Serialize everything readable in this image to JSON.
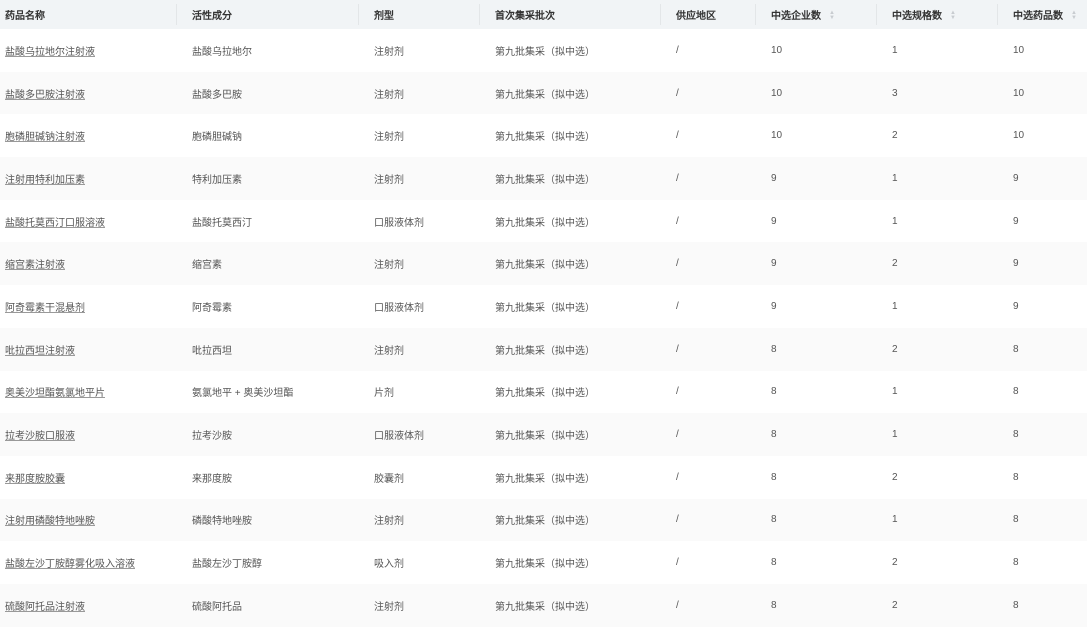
{
  "columns": [
    "药品名称",
    "活性成分",
    "剂型",
    "首次集采批次",
    "供应地区",
    "中选企业数",
    "中选规格数",
    "中选药品数"
  ],
  "rows": [
    [
      "盐酸乌拉地尔注射液",
      "盐酸乌拉地尔",
      "注射剂",
      "第九批集采（拟中选）",
      "/",
      "10",
      "1",
      "10"
    ],
    [
      "盐酸多巴胺注射液",
      "盐酸多巴胺",
      "注射剂",
      "第九批集采（拟中选）",
      "/",
      "10",
      "3",
      "10"
    ],
    [
      "胞磷胆碱钠注射液",
      "胞磷胆碱钠",
      "注射剂",
      "第九批集采（拟中选）",
      "/",
      "10",
      "2",
      "10"
    ],
    [
      "注射用特利加压素",
      "特利加压素",
      "注射剂",
      "第九批集采（拟中选）",
      "/",
      "9",
      "1",
      "9"
    ],
    [
      "盐酸托莫西汀口服溶液",
      "盐酸托莫西汀",
      "口服液体剂",
      "第九批集采（拟中选）",
      "/",
      "9",
      "1",
      "9"
    ],
    [
      "缩宫素注射液",
      "缩宫素",
      "注射剂",
      "第九批集采（拟中选）",
      "/",
      "9",
      "2",
      "9"
    ],
    [
      "阿奇霉素干混悬剂",
      "阿奇霉素",
      "口服液体剂",
      "第九批集采（拟中选）",
      "/",
      "9",
      "1",
      "9"
    ],
    [
      "吡拉西坦注射液",
      "吡拉西坦",
      "注射剂",
      "第九批集采（拟中选）",
      "/",
      "8",
      "2",
      "8"
    ],
    [
      "奥美沙坦酯氨氯地平片",
      "氨氯地平 + 奥美沙坦酯",
      "片剂",
      "第九批集采（拟中选）",
      "/",
      "8",
      "1",
      "8"
    ],
    [
      "拉考沙胺口服液",
      "拉考沙胺",
      "口服液体剂",
      "第九批集采（拟中选）",
      "/",
      "8",
      "1",
      "8"
    ],
    [
      "来那度胺胶囊",
      "来那度胺",
      "胶囊剂",
      "第九批集采（拟中选）",
      "/",
      "8",
      "2",
      "8"
    ],
    [
      "注射用磷酸特地唑胺",
      "磷酸特地唑胺",
      "注射剂",
      "第九批集采（拟中选）",
      "/",
      "8",
      "1",
      "8"
    ],
    [
      "盐酸左沙丁胺醇雾化吸入溶液",
      "盐酸左沙丁胺醇",
      "吸入剂",
      "第九批集采（拟中选）",
      "/",
      "8",
      "2",
      "8"
    ],
    [
      "硫酸阿托品注射液",
      "硫酸阿托品",
      "注射剂",
      "第九批集采（拟中选）",
      "/",
      "8",
      "2",
      "8"
    ]
  ]
}
